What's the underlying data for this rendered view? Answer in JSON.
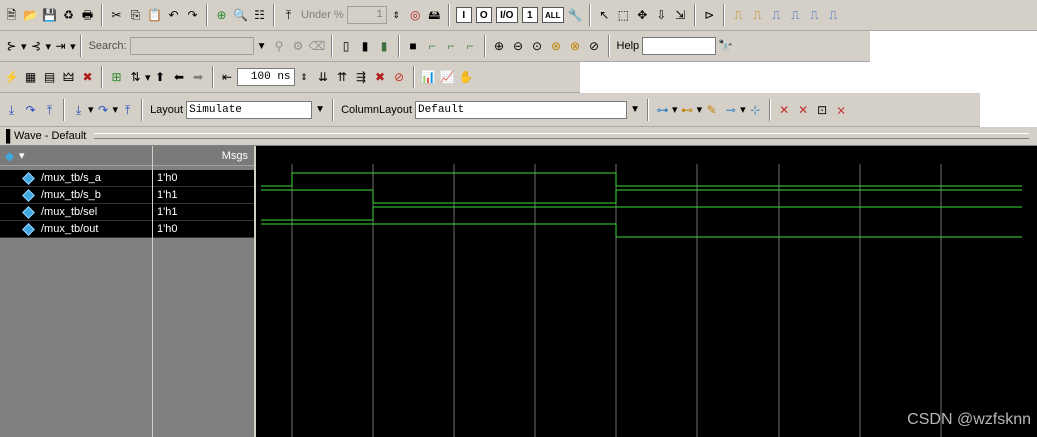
{
  "toolbar1": {
    "under_label": "Under %",
    "under_value": "1",
    "filter_I": "I",
    "filter_O": "O",
    "filter_IO": "I/O",
    "filter_1": "1",
    "filter_all": "ALL"
  },
  "toolbar2": {
    "search_label": "Search:",
    "search_value": "",
    "help_label": "Help",
    "help_value": ""
  },
  "toolbar3": {
    "run_length": "100 ns"
  },
  "toolbar4": {
    "layout_label": "Layout",
    "layout_value": "Simulate",
    "column_layout_label": "ColumnLayout",
    "column_layout_value": "Default"
  },
  "wave_window": {
    "title": "Wave - Default",
    "msgs_header": "Msgs",
    "signals": [
      {
        "name": "/mux_tb/s_a",
        "value": "1'h0"
      },
      {
        "name": "/mux_tb/s_b",
        "value": "1'h1"
      },
      {
        "name": "/mux_tb/sel",
        "value": "1'h1"
      },
      {
        "name": "/mux_tb/out",
        "value": "1'h0"
      }
    ],
    "wave_color": "#3ddc3d",
    "grid_color": "#707070",
    "waveforms": {
      "s_a": [
        0,
        1,
        1,
        1,
        1,
        0,
        0,
        0,
        0,
        0
      ],
      "s_b": [
        1,
        1,
        0,
        0,
        0,
        1,
        1,
        1,
        1,
        1
      ],
      "sel": [
        0,
        0,
        1,
        1,
        1,
        1,
        1,
        1,
        1,
        1
      ],
      "out": [
        1,
        1,
        1,
        1,
        1,
        0,
        0,
        0,
        0,
        0
      ]
    }
  },
  "watermark": "CSDN @wzfsknn"
}
